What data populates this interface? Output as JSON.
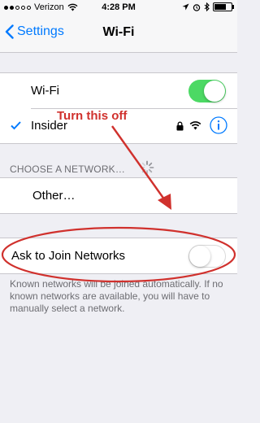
{
  "status_bar": {
    "carrier": "Verizon",
    "time": "4:28 PM"
  },
  "nav": {
    "back_label": "Settings",
    "title": "Wi-Fi"
  },
  "wifi_row": {
    "label": "Wi-Fi",
    "toggle_on": true
  },
  "connected_network": {
    "name": "Insider"
  },
  "choose_section": {
    "header": "CHOOSE A NETWORK…"
  },
  "other_row": {
    "label": "Other…"
  },
  "ask_join": {
    "label": "Ask to Join Networks",
    "toggle_on": false
  },
  "footer_text": "Known networks will be joined automatically. If no known networks are available, you will have to manually select a network.",
  "annotation": {
    "text": "Turn this off"
  },
  "colors": {
    "ios_blue": "#007aff",
    "toggle_green": "#4cd964",
    "annotation_red": "#d0312d"
  }
}
